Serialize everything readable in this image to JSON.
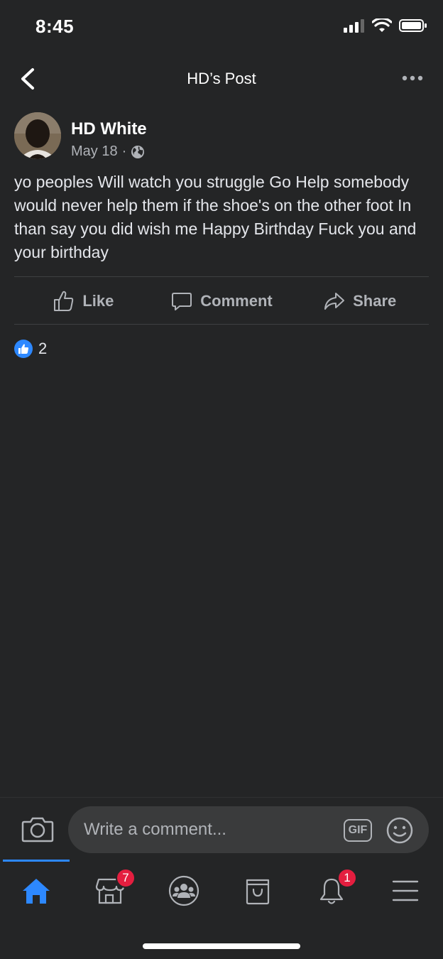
{
  "status_bar": {
    "time": "8:45"
  },
  "nav": {
    "title": "HD’s Post"
  },
  "post": {
    "author": "HD White",
    "date": "May 18",
    "separator": "·",
    "text": "yo peoples Will watch you struggle Go  Help somebody would never help them if the shoe's on the other foot  In than say you did wish me Happy Birthday Fuck you and your birthday"
  },
  "actions": {
    "like_label": "Like",
    "comment_label": "Comment",
    "share_label": "Share"
  },
  "reactions": {
    "count": "2"
  },
  "comment_bar": {
    "placeholder": "Write a comment...",
    "gif_label": "GIF"
  },
  "tab_bar": {
    "marketplace_badge": "7",
    "notifications_badge": "1"
  },
  "colors": {
    "accent": "#2d88ff",
    "badge": "#e41e3f",
    "background": "#242526"
  },
  "icons": [
    "back-icon",
    "more-icon",
    "globe-icon",
    "like-icon",
    "comment-icon",
    "share-icon",
    "camera-icon",
    "emoji-icon",
    "home-icon",
    "marketplace-icon",
    "groups-icon",
    "shop-icon",
    "bell-icon",
    "menu-icon"
  ]
}
